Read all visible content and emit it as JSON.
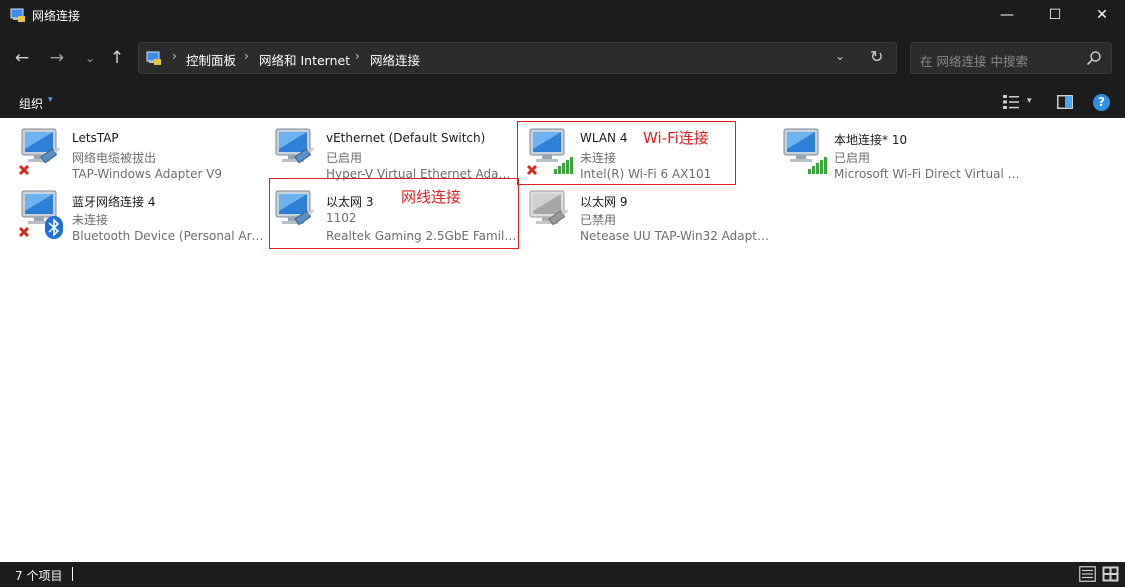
{
  "window": {
    "title": "网络连接",
    "minimize_glyph": "—",
    "maximize_glyph": "☐",
    "close_glyph": "✕"
  },
  "nav": {
    "back_glyph": "←",
    "forward_glyph": "→",
    "recent_glyph": "⌄",
    "up_glyph": "↑"
  },
  "address": {
    "breadcrumbs": [
      "控制面板",
      "网络和 Internet",
      "网络连接"
    ],
    "separator": "›",
    "dropdown_glyph": "⌄",
    "refresh_glyph": "↻"
  },
  "search": {
    "placeholder": "在 网络连接 中搜索"
  },
  "toolbar": {
    "organize_label": "组织",
    "caret": "▾",
    "help_glyph": "?"
  },
  "connections": [
    {
      "name": "LetsTAP",
      "status": "网络电缆被拔出",
      "device": "TAP-Windows Adapter V9",
      "icon": "ethernet-disconnected-icon"
    },
    {
      "name": "vEthernet (Default Switch)",
      "status": "已启用",
      "device": "Hyper-V Virtual Ethernet Adapter",
      "icon": "ethernet-icon"
    },
    {
      "name": "WLAN 4",
      "status": "未连接",
      "device": "Intel(R) Wi-Fi 6 AX101",
      "icon": "wifi-disconnected-icon"
    },
    {
      "name": "本地连接* 10",
      "status": "已启用",
      "device": "Microsoft Wi-Fi Direct Virtual Adapter",
      "icon": "wifi-icon"
    },
    {
      "name": "蓝牙网络连接 4",
      "status": "未连接",
      "device": "Bluetooth Device (Personal Area Network)",
      "icon": "bluetooth-disconnected-icon"
    },
    {
      "name": "以太网 3",
      "status": "1102",
      "device": "Realtek Gaming 2.5GbE Family Controller",
      "icon": "ethernet-icon"
    },
    {
      "name": "以太网 9",
      "status": "已禁用",
      "device": "Netease UU TAP-Win32 Adapter V9",
      "icon": "ethernet-disabled-icon"
    }
  ],
  "annotations": {
    "wifi_label": "Wi-Fi连接",
    "ethernet_label": "网线连接"
  },
  "status": {
    "item_count": "7 个项目"
  },
  "colors": {
    "annotation": "#e02020",
    "accent": "#2d8fe6",
    "background_dark": "#1c1c1c"
  }
}
